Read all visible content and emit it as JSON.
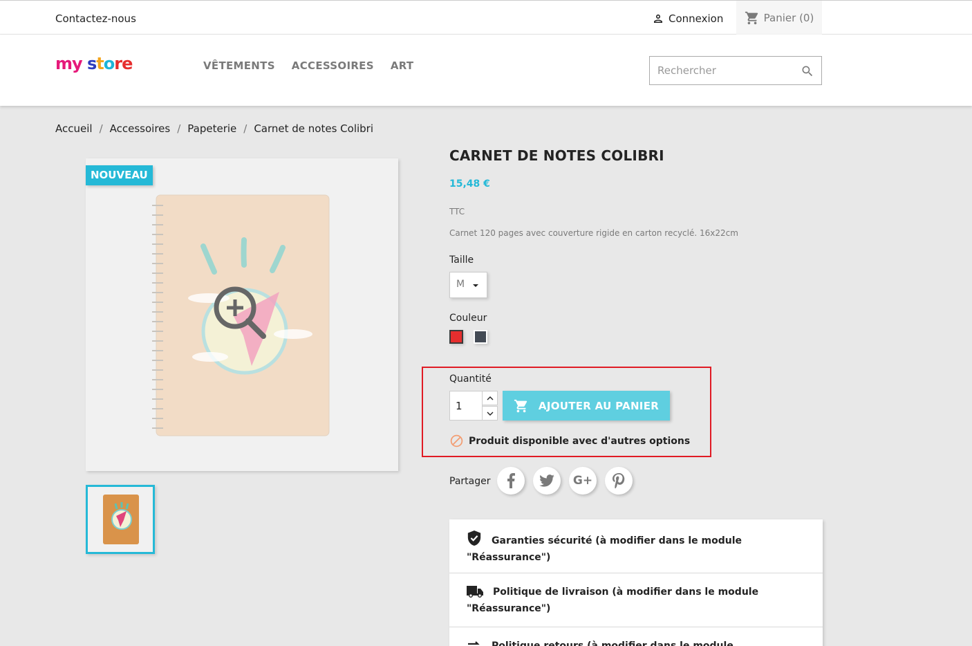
{
  "topbar": {
    "contact": "Contactez-nous",
    "login": "Connexion",
    "cart": "Panier (0)"
  },
  "header": {
    "logo": {
      "part1": "my",
      "part2": " s",
      "part3": "t",
      "part4": "o",
      "part5": "re"
    },
    "nav": [
      "VÊTEMENTS",
      "ACCESSOIRES",
      "ART"
    ],
    "search_placeholder": "Rechercher"
  },
  "breadcrumb": [
    "Accueil",
    "Accessoires",
    "Papeterie",
    "Carnet de notes Colibri"
  ],
  "product": {
    "badge": "NOUVEAU",
    "title": "CARNET DE NOTES COLIBRI",
    "price": "15,48 €",
    "tax_label": "TTC",
    "description": "Carnet 120 pages avec couverture rigide en carton recyclé. 16x22cm",
    "size_label": "Taille",
    "size_value": "M",
    "color_label": "Couleur",
    "colors": [
      "#e62e2e",
      "#434a54"
    ],
    "quantity_label": "Quantité",
    "quantity_value": "1",
    "add_to_cart": "AJOUTER AU PANIER",
    "availability": "Produit disponible avec d'autres options",
    "share_label": "Partager",
    "share_buttons": [
      "facebook-icon",
      "twitter-icon",
      "google-plus-icon",
      "pinterest-icon"
    ]
  },
  "reassurance": [
    {
      "icon": "shield-check-icon",
      "line1": "Garanties sécurité (à modifier dans le module",
      "line2": "\"Réassurance\")"
    },
    {
      "icon": "truck-icon",
      "line1": "Politique de livraison (à modifier dans le module",
      "line2": "\"Réassurance\")"
    },
    {
      "icon": "arrows-icon",
      "line1": "Politique retours (à modifier dans le module \"Réassurance\")",
      "line2": ""
    }
  ],
  "colors": {
    "accent": "#25b9d7",
    "button": "#5fcfe0",
    "highlight": "#e01b24",
    "warning": "#f39d72"
  }
}
